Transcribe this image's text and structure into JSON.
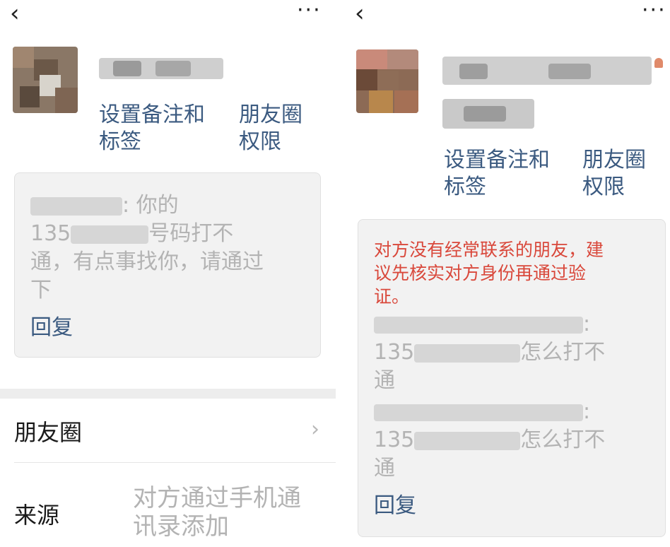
{
  "left": {
    "back_icon": "chevron-left-icon",
    "more_icon": "more-dots-icon",
    "more_label": "···",
    "actions": {
      "remark": "设置备注和\n标签",
      "moments_perm": "朋友圈\n权限"
    },
    "message": {
      "prefix": "",
      "text_a": ": 你的",
      "text_b": "135",
      "text_c": "号码打不\n通，有点事找你，请通过\n下"
    },
    "reply_label": "回复",
    "rows": [
      {
        "label": "朋友圈",
        "value": ""
      },
      {
        "label": "来源",
        "value": "对方通过手机通\n讯录添加"
      }
    ]
  },
  "right": {
    "back_icon": "chevron-left-icon",
    "more_icon": "more-dots-icon",
    "more_label": "···",
    "actions": {
      "remark": "设置备注和\n标签",
      "moments_perm": "朋友圈\n权限"
    },
    "warning": "对方没有经常联系的朋友，建\n议先核实对方身份再通过验\n证。",
    "messages": [
      {
        "suffix": ":",
        "line2_prefix": "135",
        "line2_suffix": "怎么打不",
        "line3": "通"
      },
      {
        "suffix": ":",
        "line2_prefix": "135",
        "line2_suffix": "怎么打不",
        "line3": "通"
      }
    ],
    "reply_label": "回复"
  },
  "colors": {
    "link": "#3b5a80",
    "warning": "#d9483b",
    "muted": "#b3b3b3",
    "card_bg": "#f2f2f2"
  }
}
